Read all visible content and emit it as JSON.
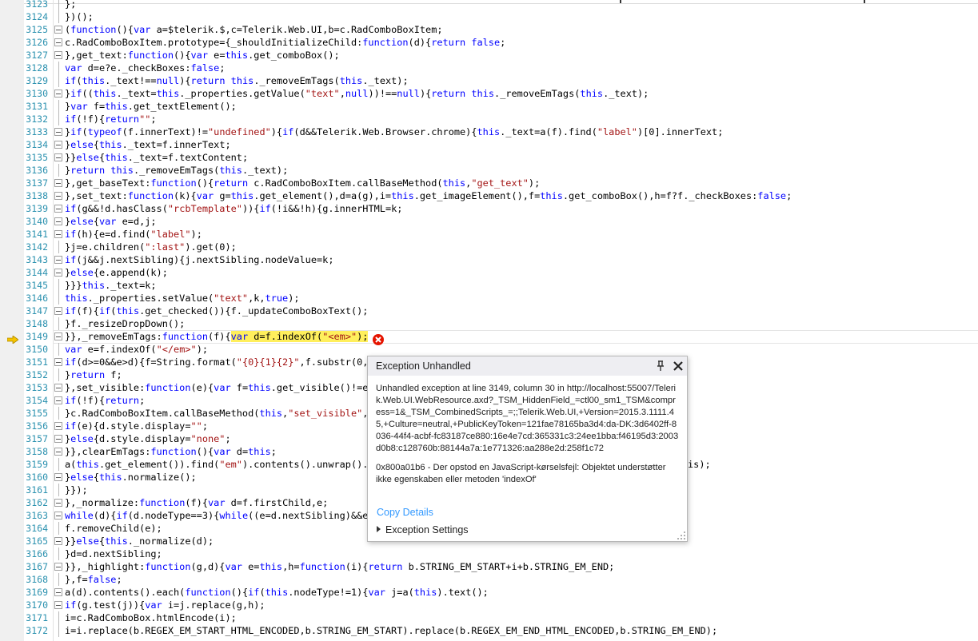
{
  "editor": {
    "lines": [
      {
        "n": "3123",
        "code": "};"
      },
      {
        "n": "3124",
        "code": "})();"
      },
      {
        "n": "3125",
        "code": "(function(){var a=$telerik.$,c=Telerik.Web.UI,b=c.RadComboBoxItem;"
      },
      {
        "n": "3126",
        "code": "c.RadComboBoxItem.prototype={_shouldInitializeChild:function(d){return false;"
      },
      {
        "n": "3127",
        "code": "},get_text:function(){var e=this.get_comboBox();"
      },
      {
        "n": "3128",
        "code": "var d=e?e._checkBoxes:false;"
      },
      {
        "n": "3129",
        "code": "if(this._text!==null){return this._removeEmTags(this._text);"
      },
      {
        "n": "3130",
        "code": "}if((this._text=this._properties.getValue(\"text\",null))!==null){return this._removeEmTags(this._text);"
      },
      {
        "n": "3131",
        "code": "}var f=this.get_textElement();"
      },
      {
        "n": "3132",
        "code": "if(!f){return\"\";"
      },
      {
        "n": "3133",
        "code": "}if(typeof(f.innerText)!=\"undefined\"){if(d&&Telerik.Web.Browser.chrome){this._text=a(f).find(\"label\")[0].innerText;"
      },
      {
        "n": "3134",
        "code": "}else{this._text=f.innerText;"
      },
      {
        "n": "3135",
        "code": "}}else{this._text=f.textContent;"
      },
      {
        "n": "3136",
        "code": "}return this._removeEmTags(this._text);"
      },
      {
        "n": "3137",
        "code": "},get_baseText:function(){return c.RadComboBoxItem.callBaseMethod(this,\"get_text\");"
      },
      {
        "n": "3138",
        "code": "},set_text:function(k){var g=this.get_element(),d=a(g),i=this.get_imageElement(),f=this.get_comboBox(),h=f?f._checkBoxes:false;"
      },
      {
        "n": "3139",
        "code": "if(g&&!d.hasClass(\"rcbTemplate\")){if(!i&&!h){g.innerHTML=k;"
      },
      {
        "n": "3140",
        "code": "}else{var e=d,j;"
      },
      {
        "n": "3141",
        "code": "if(h){e=d.find(\"label\");"
      },
      {
        "n": "3142",
        "code": "}j=e.children(\":last\").get(0);"
      },
      {
        "n": "3143",
        "code": "if(j&&j.nextSibling){j.nextSibling.nodeValue=k;"
      },
      {
        "n": "3144",
        "code": "}else{e.append(k);"
      },
      {
        "n": "3145",
        "code": "}}}this._text=k;"
      },
      {
        "n": "3146",
        "code": "this._properties.setValue(\"text\",k,true);"
      },
      {
        "n": "3147",
        "code": "if(f){if(this.get_checked()){f._updateComboBoxText();"
      },
      {
        "n": "3148",
        "code": "}f._resizeDropDown();"
      },
      {
        "n": "3149",
        "code": "}},_removeEmTags:function(f){var d=f.indexOf(\"<em>\");"
      },
      {
        "n": "3150",
        "code": "var e=f.indexOf(\"</em>\");"
      },
      {
        "n": "3151",
        "code": "if(d>=0&&e>d){f=String.format(\"{0}{1}{2}\",f.substr(0,d"
      },
      {
        "n": "3152",
        "code": "}return f;"
      },
      {
        "n": "3153",
        "code": "},set_visible:function(e){var f=this.get_visible()!=e,"
      },
      {
        "n": "3154",
        "code": "if(!f){return;"
      },
      {
        "n": "3155",
        "code": "}c.RadComboBoxItem.callBaseMethod(this,\"set_visible\",["
      },
      {
        "n": "3156",
        "code": "if(e){d.style.display=\"\";"
      },
      {
        "n": "3157",
        "code": "}else{d.style.display=\"none\";"
      },
      {
        "n": "3158",
        "code": "}},clearEmTags:function(){var d=this;"
      },
      {
        "n": "3159",
        "code": "a(this.get_element()).find(\"em\").contents().unwrap().p"
      },
      {
        "n": "3160",
        "code": "}else{this.normalize();"
      },
      {
        "n": "3161",
        "code": "}});"
      },
      {
        "n": "3162",
        "code": "},_normalize:function(f){var d=f.firstChild,e;"
      },
      {
        "n": "3163",
        "code": "while(d){if(d.nodeType==3){while((e=d.nextSibling)&&e."
      },
      {
        "n": "3164",
        "code": "f.removeChild(e);"
      },
      {
        "n": "3165",
        "code": "}}else{this._normalize(d);"
      },
      {
        "n": "3166",
        "code": "}d=d.nextSibling;"
      },
      {
        "n": "3167",
        "code": "}},_highlight:function(g,d){var e=this,h=function(i){return b.STRING_EM_START+i+b.STRING_EM_END;"
      },
      {
        "n": "3168",
        "code": "},f=false;"
      },
      {
        "n": "3169",
        "code": "a(d).contents().each(function(){if(this.nodeType!=1){var j=a(this).text();"
      },
      {
        "n": "3170",
        "code": "if(g.test(j)){var i=j.replace(g,h);"
      },
      {
        "n": "3171",
        "code": "i=c.RadComboBox.htmlEncode(i);"
      },
      {
        "n": "3172",
        "code": "i=i.replace(b.REGEX_EM_START_HTML_ENCODED,b.STRING_EM_START).replace(b.REGEX_EM_END_HTML_ENCODED,b.STRING_EM_END);"
      }
    ],
    "line_3159_tail": "is);",
    "fold_lines": [
      "3125",
      "3126",
      "3127",
      "3130",
      "3133",
      "3134",
      "3135",
      "3137",
      "3138",
      "3139",
      "3140",
      "3141",
      "3143",
      "3144",
      "3147",
      "3149",
      "3151",
      "3153",
      "3154",
      "3156",
      "3157",
      "3158",
      "3160",
      "3162",
      "3163",
      "3165",
      "3167",
      "3169",
      "3170"
    ],
    "current_line": "3149",
    "highlighted_statement": "var d=f.indexOf(\"<em>\");"
  },
  "exception_popup": {
    "title": "Exception Unhandled",
    "message": "Unhandled exception at line 3149, column 30 in http://localhost:55007/Telerik.Web.UI.WebResource.axd?_TSM_HiddenField_=ctl00_sm1_TSM&compress=1&_TSM_CombinedScripts_=;;Telerik.Web.UI,+Version=2015.3.1111.45,+Culture=neutral,+PublicKeyToken=121fae78165ba3d4:da-DK:3d6402ff-8036-44f4-acbf-fc83187ce880:16e4e7cd:365331c3:24ee1bba:f46195d3:2003d0b8:c128760b:88144a7a:1e771326:aa288e2d:258f1c72",
    "error": "0x800a01b6 - Der opstod en JavaScript-kørselsfejl: Objektet understøtter ikke egenskaben eller metoden 'indexOf'",
    "copy_details": "Copy Details",
    "exception_settings": "Exception Settings"
  },
  "colors": {
    "line_number": "#2b91af",
    "keyword": "#0000ff",
    "string": "#a31515",
    "current_statement": "#ffef5c",
    "link": "#3399ff",
    "error_glyph": "#e51400"
  },
  "icons": {
    "execution_pointer": "arrow-right-icon",
    "error": "error-circle-icon",
    "pin": "pin-icon",
    "close": "close-icon"
  }
}
